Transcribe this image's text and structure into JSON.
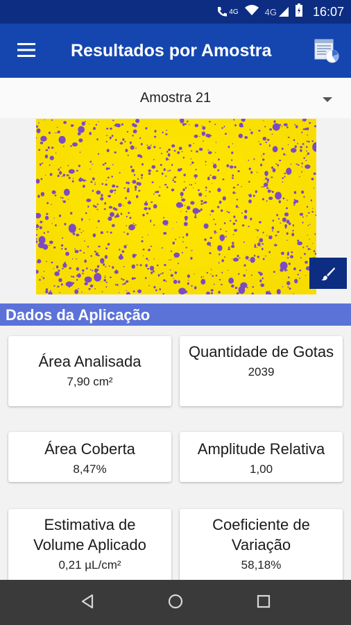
{
  "status_bar": {
    "time": "16:07",
    "network_label": "4G",
    "network_label_2": "4G"
  },
  "app_bar": {
    "title": "Resultados por Amostra"
  },
  "sample_selector": {
    "selected": "Amostra 21"
  },
  "section": {
    "title": "Dados da Aplicação"
  },
  "cards": [
    {
      "label": "Área Analisada",
      "value": "7,90 cm²"
    },
    {
      "label": "Quantidade de Gotas",
      "value": "2039"
    },
    {
      "label": "Área Coberta",
      "value": "8,47%"
    },
    {
      "label": "Amplitude Relativa",
      "value": "1,00"
    },
    {
      "label": "Estimativa de Volume Aplicado",
      "value": "0,21 µL/cm²"
    },
    {
      "label": "Coeficiente de Variação",
      "value": "58,18%"
    }
  ],
  "colors": {
    "status_bar": "#0d2d82",
    "app_bar": "#1546b0",
    "section_header": "#5b72d8",
    "sample_background": "#ffe600",
    "droplet": "#7b4bc4"
  }
}
